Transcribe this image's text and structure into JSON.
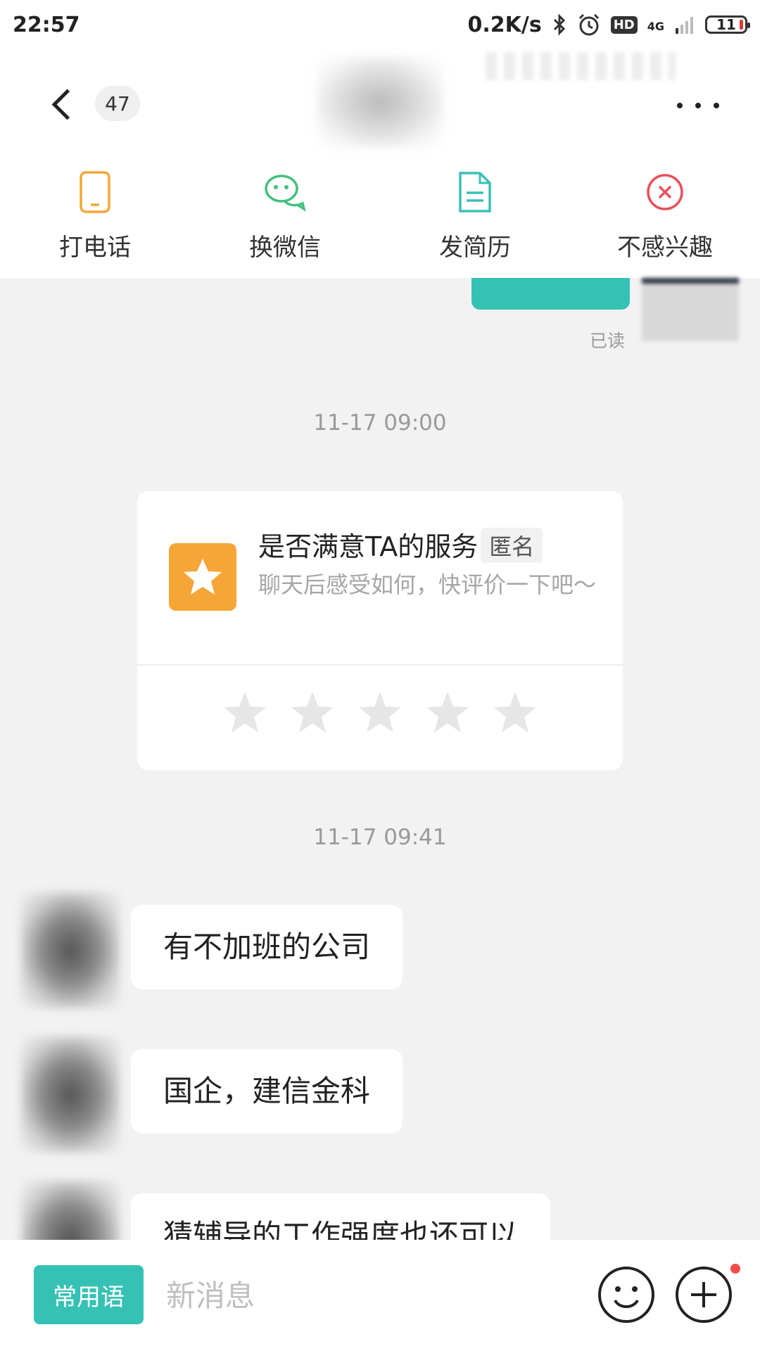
{
  "status_bar": {
    "time": "22:57",
    "network_speed": "0.2K/s",
    "hd_label": "HD",
    "network_type": "4G",
    "battery": "11",
    "icons": [
      "bluetooth-icon",
      "alarm-icon",
      "signal-icon",
      "battery-icon"
    ]
  },
  "header": {
    "unread_count": "47",
    "icons": [
      "back-arrow-icon",
      "more-options-icon"
    ]
  },
  "actions": [
    {
      "label": "打电话",
      "icon": "phone-icon",
      "color": "#f6a537"
    },
    {
      "label": "换微信",
      "icon": "wechat-icon",
      "color": "#43c07c"
    },
    {
      "label": "发简历",
      "icon": "resume-icon",
      "color": "#3cbfb7"
    },
    {
      "label": "不感兴趣",
      "icon": "not-interested-icon",
      "color": "#e8505b"
    }
  ],
  "chat": {
    "read_status": "已读",
    "timestamps": [
      "11-17 09:00",
      "11-17 09:41"
    ],
    "rating_card": {
      "title": "是否满意TA的服务",
      "tag": "匿名",
      "subtitle": "聊天后感受如何，快评价一下吧～",
      "star_count": 5,
      "icon": "star-icon"
    },
    "messages": [
      {
        "text": "有不加班的公司"
      },
      {
        "text": "国企，建信金科"
      },
      {
        "text": "猜辅导的工作强度也还可以"
      }
    ]
  },
  "input_bar": {
    "quick_phrases_label": "常用语",
    "placeholder": "新消息",
    "icons": [
      "emoji-icon",
      "plus-icon"
    ]
  },
  "colors": {
    "accent": "#35c2b4",
    "rating_orange": "#f6a537",
    "notification_red": "#f24c4c"
  }
}
